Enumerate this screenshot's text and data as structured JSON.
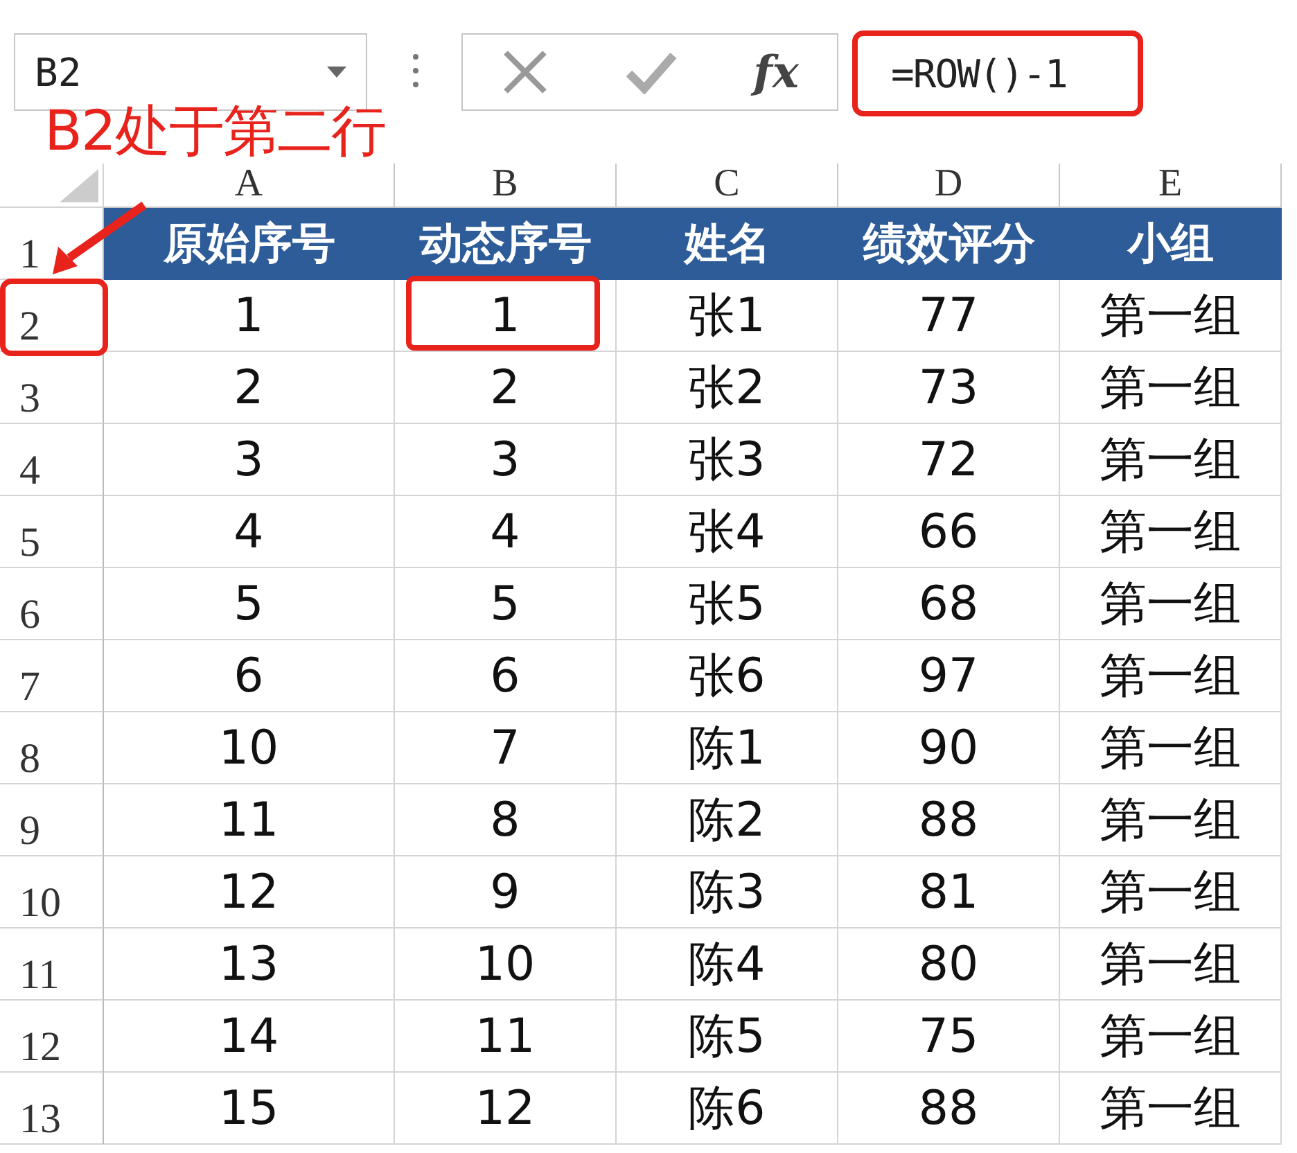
{
  "name_box": {
    "value": "B2"
  },
  "formula_bar": {
    "function_label": "fx",
    "formula": "=ROW()-1"
  },
  "annotation": {
    "text": "B2处于第二行"
  },
  "columns": [
    "A",
    "B",
    "C",
    "D",
    "E"
  ],
  "rows": [
    {
      "kind": "header",
      "number": "1",
      "cells": [
        "原始序号",
        "动态序号",
        "姓名",
        "绩效评分",
        "小组"
      ]
    },
    {
      "kind": "data",
      "number": "2",
      "cells": [
        "1",
        "1",
        "张1",
        "77",
        "第一组"
      ]
    },
    {
      "kind": "data",
      "number": "3",
      "cells": [
        "2",
        "2",
        "张2",
        "73",
        "第一组"
      ]
    },
    {
      "kind": "data",
      "number": "4",
      "cells": [
        "3",
        "3",
        "张3",
        "72",
        "第一组"
      ]
    },
    {
      "kind": "data",
      "number": "5",
      "cells": [
        "4",
        "4",
        "张4",
        "66",
        "第一组"
      ]
    },
    {
      "kind": "data",
      "number": "6",
      "cells": [
        "5",
        "5",
        "张5",
        "68",
        "第一组"
      ]
    },
    {
      "kind": "data",
      "number": "7",
      "cells": [
        "6",
        "6",
        "张6",
        "97",
        "第一组"
      ]
    },
    {
      "kind": "data",
      "number": "8",
      "cells": [
        "10",
        "7",
        "陈1",
        "90",
        "第一组"
      ]
    },
    {
      "kind": "data",
      "number": "9",
      "cells": [
        "11",
        "8",
        "陈2",
        "88",
        "第一组"
      ]
    },
    {
      "kind": "data",
      "number": "10",
      "cells": [
        "12",
        "9",
        "陈3",
        "81",
        "第一组"
      ]
    },
    {
      "kind": "data",
      "number": "11",
      "cells": [
        "13",
        "10",
        "陈4",
        "80",
        "第一组"
      ]
    },
    {
      "kind": "data",
      "number": "12",
      "cells": [
        "14",
        "11",
        "陈5",
        "75",
        "第一组"
      ]
    },
    {
      "kind": "data",
      "number": "13",
      "cells": [
        "15",
        "12",
        "陈6",
        "88",
        "第一组"
      ]
    }
  ]
}
